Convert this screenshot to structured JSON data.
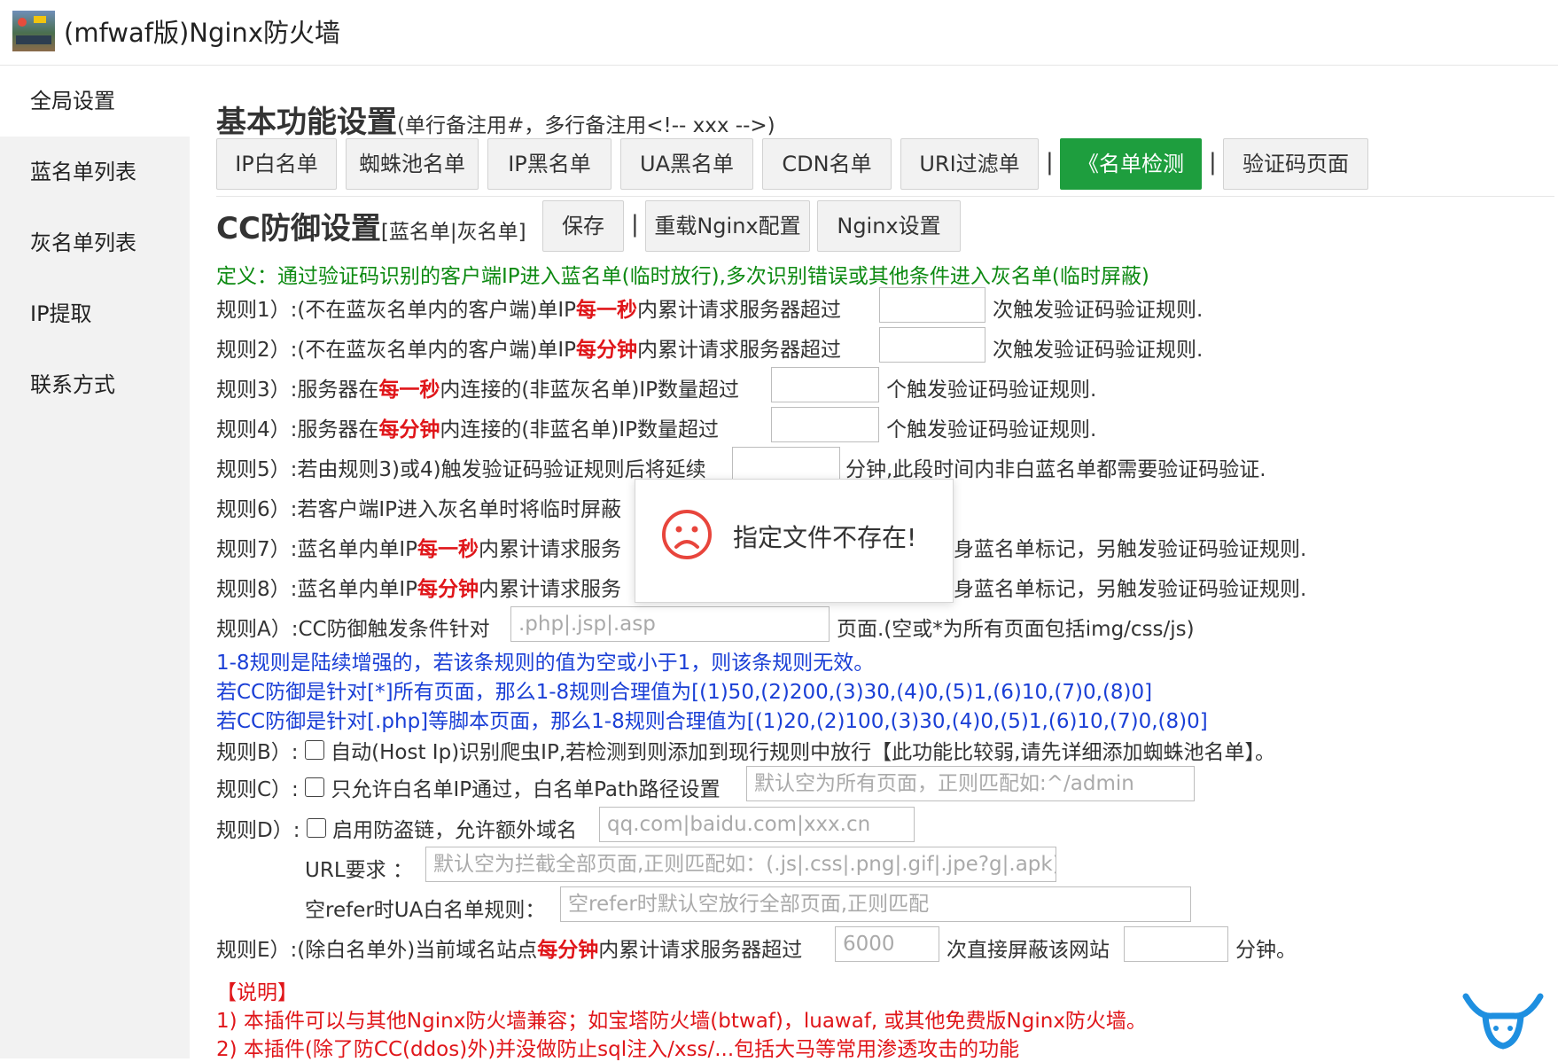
{
  "app": {
    "title": "(mfwaf版)Nginx防火墙"
  },
  "sidebar": {
    "items": [
      {
        "label": "全局设置"
      },
      {
        "label": "蓝名单列表"
      },
      {
        "label": "灰名单列表"
      },
      {
        "label": "IP提取"
      },
      {
        "label": "联系方式"
      }
    ],
    "active_index": 0
  },
  "section1": {
    "title": "基本功能设置",
    "note": "(单行备注用#，多行备注用<!-- xxx -->)"
  },
  "tabs": [
    {
      "label": "IP白名单"
    },
    {
      "label": "蜘蛛池名单"
    },
    {
      "label": "IP黑名单"
    },
    {
      "label": "UA黑名单"
    },
    {
      "label": "CDN名单"
    },
    {
      "label": "URI过滤单"
    },
    {
      "label": "《名单检测"
    },
    {
      "label": "验证码页面"
    }
  ],
  "separator": "|",
  "section2": {
    "title": "CC防御设置",
    "note": "[蓝名单|灰名单]",
    "buttons": {
      "save": "保存",
      "reload": "重载Nginx配置",
      "settings": "Nginx设置"
    }
  },
  "definition": "定义：通过验证码识别的客户端IP进入蓝名单(临时放行),多次识别错误或其他条件进入灰名单(临时屏蔽)",
  "rules": {
    "r1": {
      "pre": "规则1）:(不在蓝灰名单内的客户端)单IP",
      "hl": "每一秒",
      "post": "内累计请求服务器超过",
      "suffix": "次触发验证码验证规则."
    },
    "r2": {
      "pre": "规则2）:(不在蓝灰名单内的客户端)单IP",
      "hl": "每分钟",
      "post": "内累计请求服务器超过",
      "suffix": "次触发验证码验证规则."
    },
    "r3": {
      "pre": "规则3）:服务器在",
      "hl": "每一秒",
      "post": "内连接的(非蓝灰名单)IP数量超过",
      "suffix": "个触发验证码验证规则."
    },
    "r4": {
      "pre": "规则4）:服务器在",
      "hl": "每分钟",
      "post": "内连接的(非蓝名单)IP数量超过",
      "suffix": "个触发验证码验证规则."
    },
    "r5": {
      "pre": "规则5）:若由规则3)或4)触发验证码验证规则后将延续",
      "suffix": "分钟,此段时间内非白蓝名单都需要验证码验证."
    },
    "r6": {
      "pre": "规则6）:若客户端IP进入灰名单时将临时屏蔽"
    },
    "r7": {
      "pre": "规则7）:蓝名单内单IP",
      "hl": "每一秒",
      "post": "内累计请求服务",
      "suffix": "身蓝名单标记，另触发验证码验证规则."
    },
    "r8": {
      "pre": "规则8）:蓝名单内单IP",
      "hl": "每分钟",
      "post": "内累计请求服务",
      "suffix": "身蓝名单标记，另触发验证码验证规则."
    },
    "rA": {
      "pre": "规则A）:CC防御触发条件针对",
      "placeholder": ".php|.jsp|.asp",
      "suffix": "页面.(空或*为所有页面包括img/css/js)"
    },
    "notes": [
      "1-8规则是陆续增强的，若该条规则的值为空或小于1，则该条规则无效。",
      "若CC防御是针对[*]所有页面，那么1-8规则合理值为[(1)50,(2)200,(3)30,(4)0,(5)1,(6)10,(7)0,(8)0]",
      "若CC防御是针对[.php]等脚本页面，那么1-8规则合理值为[(1)20,(2)100,(3)30,(4)0,(5)1,(6)10,(7)0,(8)0]"
    ],
    "rB": {
      "pre": "规则B）:",
      "text": "自动(Host Ip)识别爬虫IP,若检测到则添加到现行规则中放行【此功能比较弱,请先详细添加蜘蛛池名单】。"
    },
    "rC": {
      "pre": "规则C）:",
      "text": "只允许白名单IP通过，白名单Path路径设置",
      "placeholder": "默认空为所有页面，正则匹配如:^/admin"
    },
    "rD": {
      "pre": "规则D）:",
      "text": "启用防盗链，允许额外域名",
      "placeholder": "qq.com|baidu.com|xxx.cn"
    },
    "rD_url": {
      "label": "URL要求 ：",
      "placeholder": "默认空为拦截全部页面,正则匹配如：(.js|.css|.png|.gif|.jpe?g|.apk)$"
    },
    "rD_ua": {
      "label": "空refer时UA白名单规则：",
      "placeholder": "空refer时默认空放行全部页面,正则匹配"
    },
    "rE": {
      "pre": "规则E）:(除白名单外)当前域名站点",
      "hl": "每分钟",
      "post": "内累计请求服务器超过",
      "placeholder": "6000",
      "mid": "次直接屏蔽该网站",
      "suffix": "分钟。"
    }
  },
  "explain": {
    "title": "【说明】",
    "line1": "1) 本插件可以与其他Nginx防火墙兼容；如宝塔防火墙(btwaf)，luawaf, 或其他免费版Nginx防火墙。",
    "line2": "2) 本插件(除了防CC(ddos)外)并没做防止sql注入/xss/...包括大马等常用渗透攻击的功能"
  },
  "toast": {
    "message": "指定文件不存在!",
    "icon": "sad-face-icon"
  },
  "colors": {
    "accent_green": "#1e9e3e",
    "highlight_red": "#e0161a",
    "note_blue": "#1a3fd6",
    "definition_green": "#0d8a12"
  }
}
